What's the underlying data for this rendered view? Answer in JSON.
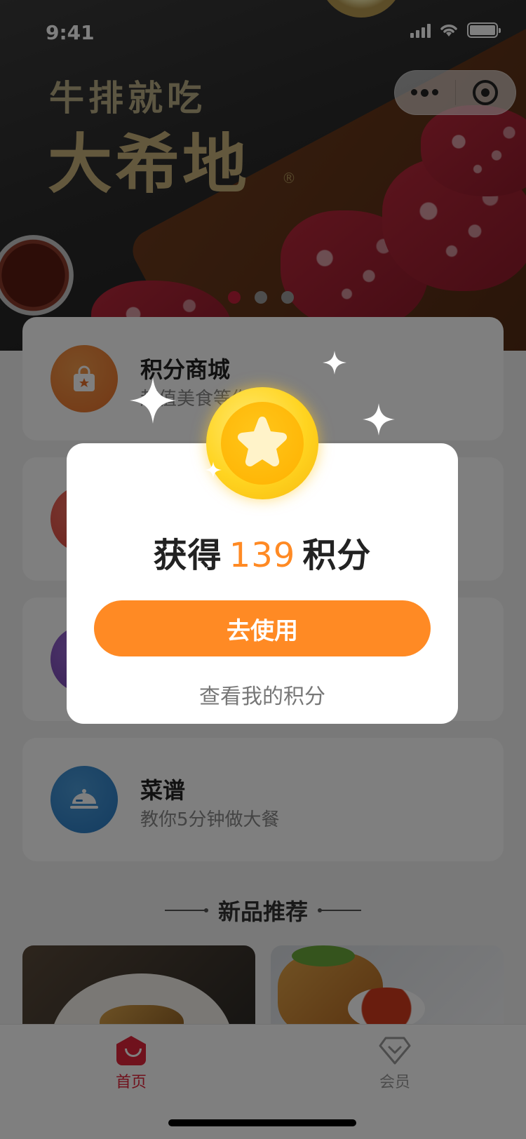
{
  "status_bar": {
    "time": "9:41"
  },
  "hero": {
    "title_line1": "牛排就吃",
    "title_line2": "大希地",
    "registered_mark": "®",
    "carousel_pages": 3,
    "carousel_active_index": 0
  },
  "cards": [
    {
      "title": "积分商城",
      "subtitle": "超值美食等你来",
      "icon": "shopping-bag-icon",
      "icon_color": "#e8702a"
    },
    {
      "title": "",
      "subtitle": "",
      "icon": "card-icon",
      "icon_color": "#d9433b"
    },
    {
      "title": "",
      "subtitle": "",
      "icon": "card-icon",
      "icon_color": "#6e3fa8"
    },
    {
      "title": "菜谱",
      "subtitle": "教你5分钟做大餐",
      "icon": "food-cloche-icon",
      "icon_color": "#2879c2"
    }
  ],
  "section": {
    "title": "新品推荐"
  },
  "modal": {
    "prefix": "获得",
    "points": "139",
    "suffix": "积分",
    "use_button": "去使用",
    "view_link": "查看我的积分",
    "icon": "star-coin-icon",
    "accent_color": "#ff8a24"
  },
  "tabbar": {
    "tabs": [
      {
        "label": "首页",
        "icon": "home-icon",
        "active": true
      },
      {
        "label": "会员",
        "icon": "diamond-icon",
        "active": false
      }
    ],
    "active_color": "#e0243a"
  }
}
